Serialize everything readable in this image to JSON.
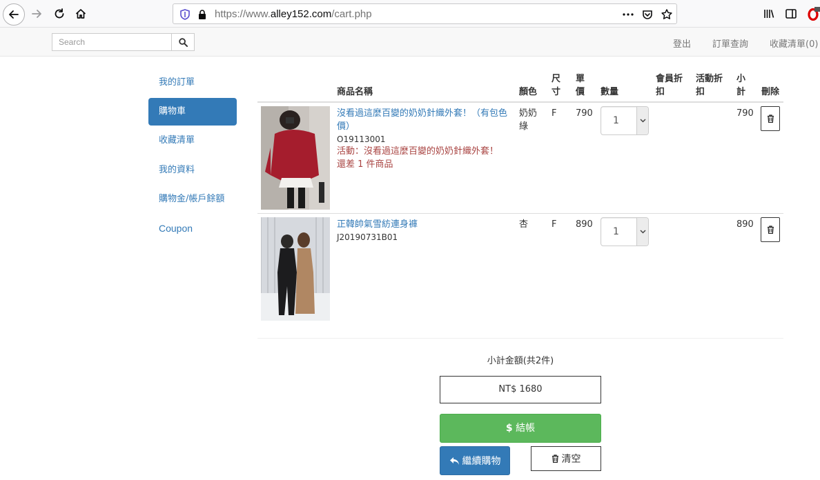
{
  "browser": {
    "url_prefix": "https://www.",
    "url_domain": "alley152.com",
    "url_path": "/cart.php"
  },
  "header": {
    "search_placeholder": "Search",
    "links": [
      "登出",
      "訂單查詢",
      "收藏清單(0)"
    ]
  },
  "sidebar": {
    "items": [
      {
        "label": "我的訂單",
        "active": false
      },
      {
        "label": "購物車",
        "active": true
      },
      {
        "label": "收藏清單",
        "active": false
      },
      {
        "label": "我的資料",
        "active": false
      },
      {
        "label": "購物金/帳戶餘額",
        "active": false
      },
      {
        "label": "Coupon",
        "active": false
      }
    ]
  },
  "table": {
    "headers": {
      "name": "商品名稱",
      "color": "顏色",
      "size_1": "尺",
      "size_2": "寸",
      "price_1": "單",
      "price_2": "價",
      "qty": "數量",
      "member_disc_1": "會員折",
      "member_disc_2": "扣",
      "event_disc_1": "活動折",
      "event_disc_2": "扣",
      "subtotal_1": "小",
      "subtotal_2": "計",
      "delete": "刪除"
    },
    "rows": [
      {
        "name_line1": "沒看過這麼百變的奶奶針織外套！（有包色",
        "name_line2": "價）",
        "sku": "O19113001",
        "promo_line1": "活動：沒看過這麼百變的奶奶針織外套！",
        "promo_line2": "還差 1 件商品",
        "color_line1": "奶奶",
        "color_line2": "綠",
        "size": "F",
        "price": "790",
        "qty": "1",
        "subtotal": "790"
      },
      {
        "name_line1": "正韓帥氣雪紡連身褲",
        "sku": "J20190731B01",
        "color_line1": "杏",
        "size": "F",
        "price": "890",
        "qty": "1",
        "subtotal": "890"
      }
    ]
  },
  "summary": {
    "subtotal_label": "小計金額(共2件)",
    "total": "NT$ 1680",
    "checkout_label": "結帳",
    "continue_label": "繼續購物",
    "clear_label": "清空"
  },
  "colors": {
    "primary": "#337ab7",
    "success": "#5cb85c",
    "promo": "#a94442"
  }
}
